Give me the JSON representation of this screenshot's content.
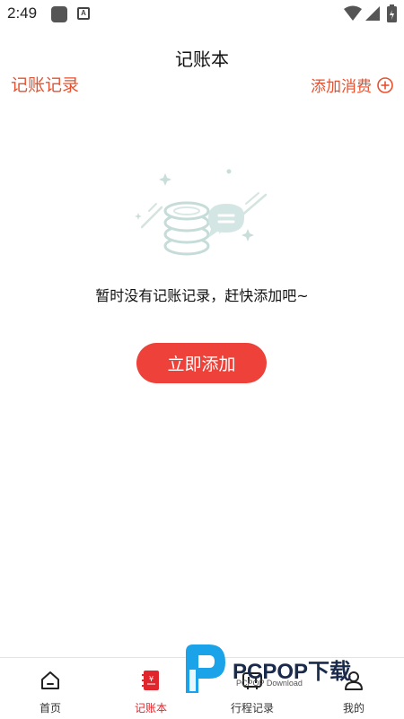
{
  "status_bar": {
    "time": "2:49"
  },
  "header": {
    "title": "记账本",
    "left_link": "记账记录",
    "right_link": "添加消费"
  },
  "empty_state": {
    "message": "暂时没有记账记录，赶快添加吧~",
    "button_label": "立即添加"
  },
  "bottom_nav": {
    "items": [
      {
        "label": "首页",
        "icon": "home-icon"
      },
      {
        "label": "记账本",
        "icon": "notebook-icon"
      },
      {
        "label": "行程记录",
        "icon": "itinerary-icon"
      },
      {
        "label": "我的",
        "icon": "profile-icon"
      }
    ],
    "active_index": 1
  },
  "watermark": {
    "brand": "PCPOP下载",
    "sub": "PCPOP Download"
  },
  "colors": {
    "accent": "#e8502d",
    "button": "#ee4139",
    "active_nav": "#e0262c"
  }
}
